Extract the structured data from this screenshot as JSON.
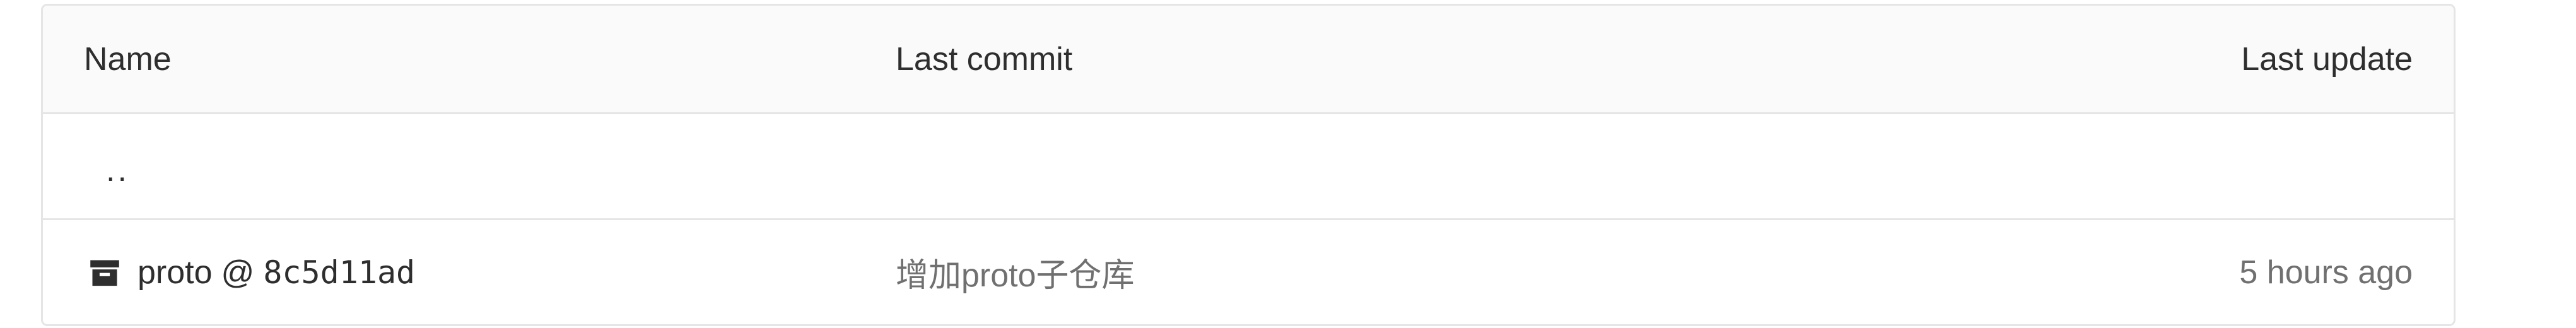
{
  "table": {
    "headers": {
      "name": "Name",
      "last_commit": "Last commit",
      "last_update": "Last update"
    },
    "parent_link": "..",
    "rows": [
      {
        "icon": "archive-icon",
        "name": "proto",
        "at": "@",
        "sha": "8c5d11ad",
        "commit_message": "增加proto子仓库",
        "updated": "5 hours ago"
      }
    ]
  },
  "colors": {
    "border": "#e5e5e5",
    "header_bg": "#fafafa",
    "text": "#2e2e2e",
    "muted_text": "#707070"
  }
}
